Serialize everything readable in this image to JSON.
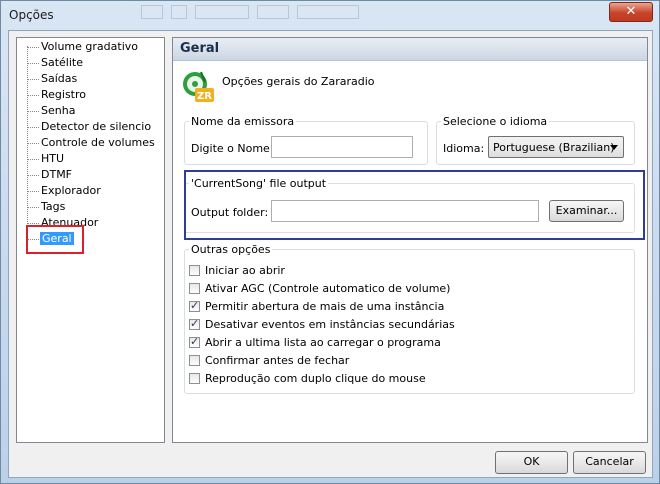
{
  "window": {
    "title": "Opções",
    "close_glyph": "✕"
  },
  "tree": {
    "items": [
      "Volume gradativo",
      "Satélite",
      "Saídas",
      "Registro",
      "Senha",
      "Detector de silencio",
      "Controle de volumes",
      "HTU",
      "DTMF",
      "Explorador",
      "Tags",
      "Atenuador",
      "Geral"
    ],
    "selected_index": 12
  },
  "panel": {
    "title": "Geral",
    "subtitle": "Opções gerais do Zararadio",
    "logo_text": "ZR",
    "station": {
      "legend": "Nome da emissora",
      "label": "Digite o Nome:",
      "value": ""
    },
    "language": {
      "legend": "Selecione o idioma",
      "label": "Idioma:",
      "value": "Portuguese (Brazilian)"
    },
    "currentsong": {
      "legend": "'CurrentSong' file output",
      "label": "Output folder:",
      "value": "",
      "browse_label": "Examinar..."
    },
    "other": {
      "legend": "Outras opções",
      "options": [
        {
          "label": "Iniciar ao abrir",
          "checked": false
        },
        {
          "label": "Ativar AGC (Controle automatico de volume)",
          "checked": false
        },
        {
          "label": "Permitir abertura de mais de uma instância",
          "checked": true
        },
        {
          "label": "Desativar eventos em instâncias secundárias",
          "checked": true
        },
        {
          "label": "Abrir a ultima lista ao carregar o programa",
          "checked": true
        },
        {
          "label": "Confirmar antes de fechar",
          "checked": false
        },
        {
          "label": "Reprodução com duplo clique do mouse",
          "checked": false
        }
      ]
    }
  },
  "buttons": {
    "ok": "OK",
    "cancel": "Cancelar"
  }
}
